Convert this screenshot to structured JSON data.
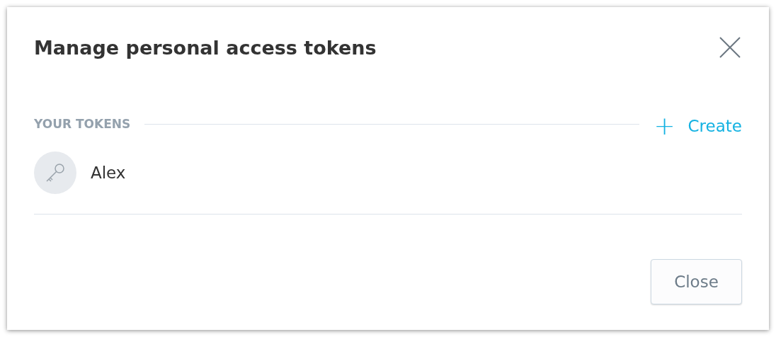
{
  "dialog": {
    "title": "Manage personal access tokens",
    "section": {
      "label": "YOUR TOKENS",
      "create_button": {
        "icon": "+",
        "label": "Create"
      }
    },
    "tokens": [
      {
        "name": "Alex"
      }
    ],
    "buttons": [
      {
        "label": "Close"
      }
    ]
  }
}
